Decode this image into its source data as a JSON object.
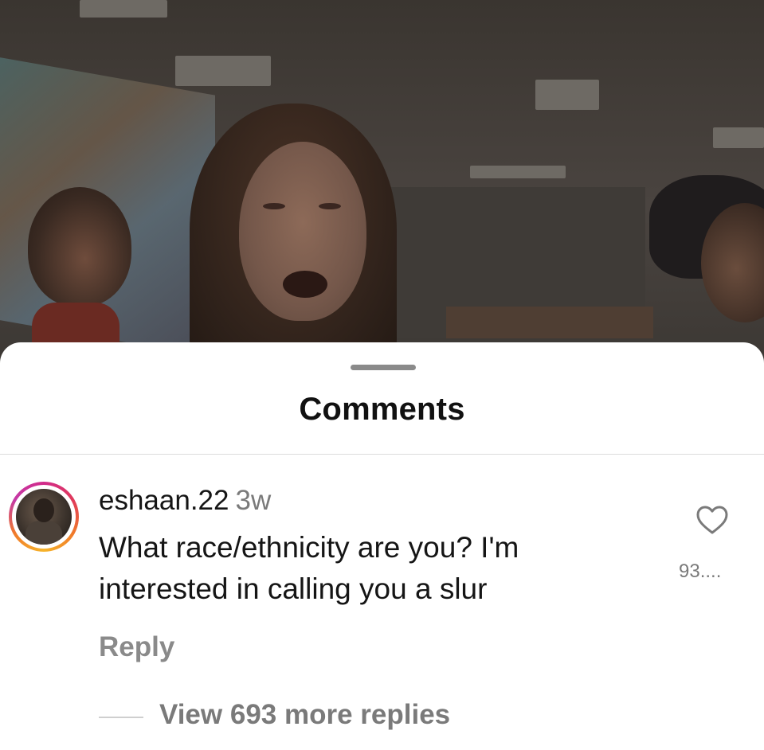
{
  "sheet": {
    "title": "Comments"
  },
  "comment": {
    "username": "eshaan.22",
    "time": "3w",
    "text": "What race/ethnicity are you? I'm interested in calling you a slur",
    "reply_label": "Reply",
    "like_count": "93....",
    "view_replies_label": "View 693 more replies"
  },
  "icons": {
    "like": "heart-icon",
    "avatar": "user-avatar"
  },
  "colors": {
    "story_ring_start": "#d12a8a",
    "story_ring_end": "#f6b42a",
    "muted_text": "#7a7a7a",
    "primary_text": "#151515"
  }
}
